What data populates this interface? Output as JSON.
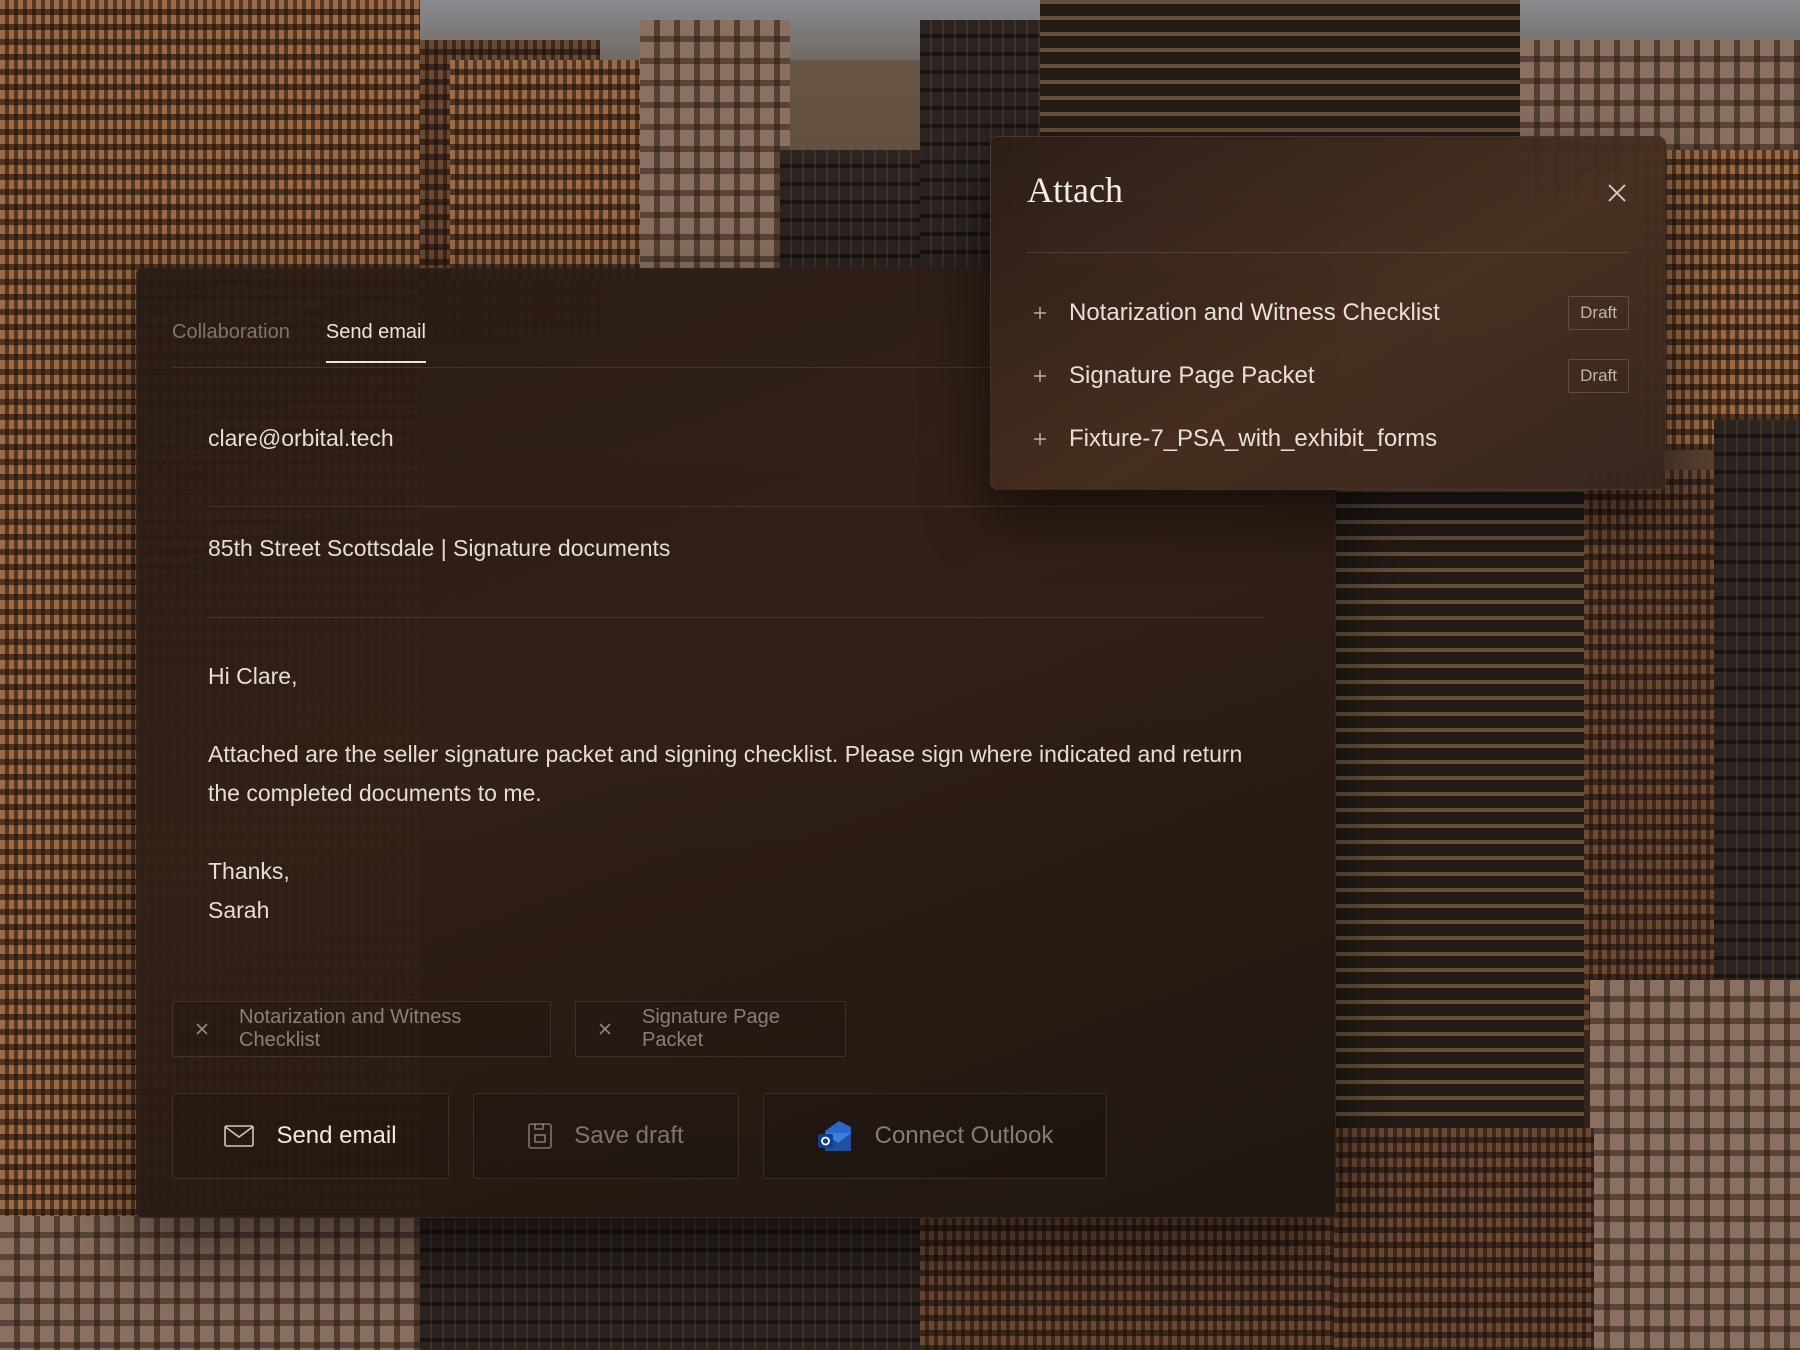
{
  "tabs": {
    "collaboration": "Collaboration",
    "send_email": "Send email",
    "active": "send_email"
  },
  "email": {
    "to": "clare@orbital.tech",
    "subject": "85th Street Scottsdale | Signature documents",
    "greeting": "Hi Clare,",
    "body": "Attached are the seller signature packet and signing checklist. Please sign where indicated and return the completed documents to me.",
    "signoff": "Thanks,",
    "signature": "Sarah"
  },
  "attached_chips": [
    {
      "label": "Notarization and Witness Checklist",
      "remove_icon": "close-icon"
    },
    {
      "label": "Signature Page Packet",
      "remove_icon": "close-icon"
    }
  ],
  "actions": {
    "send_label": "Send email",
    "send_icon": "mail-icon",
    "save_label": "Save draft",
    "save_icon": "save-icon",
    "outlook_label": "Connect Outlook",
    "outlook_icon": "outlook-icon"
  },
  "attach_panel": {
    "title": "Attach",
    "close_icon": "close-icon",
    "items": [
      {
        "name": "Notarization and Witness Checklist",
        "badge": "Draft"
      },
      {
        "name": "Signature Page Packet",
        "badge": "Draft"
      },
      {
        "name": "Fixture-7_PSA_with_exhibit_forms",
        "badge": ""
      }
    ]
  },
  "colors": {
    "panel_bg": "#2c1e16",
    "text_primary": "#e6ddd4",
    "text_muted": "#8c8078",
    "outlook_blue": "#1f5fb8"
  }
}
